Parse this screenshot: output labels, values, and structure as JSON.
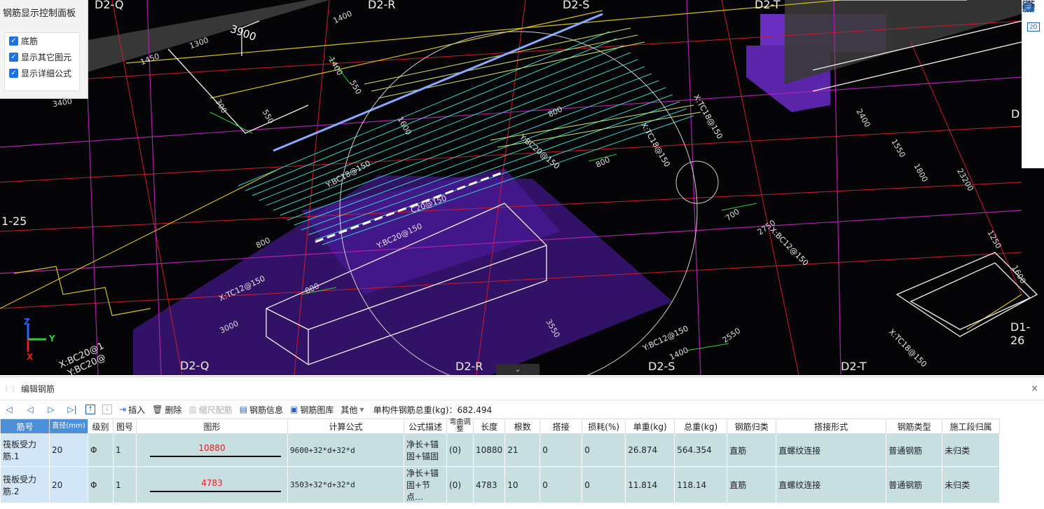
{
  "panel": {
    "title": "钢筋显示控制面板",
    "options": [
      {
        "label": "底筋",
        "checked": true
      },
      {
        "label": "显示其它图元",
        "checked": true
      },
      {
        "label": "显示详细公式",
        "checked": true
      }
    ]
  },
  "viewport": {
    "axis_labels": {
      "d2q_top": "D2-Q",
      "d2r_top": "D2-R",
      "d2s_top": "D2-S",
      "d2t_top": "D2-T",
      "d2q_bot": "D2-Q",
      "d2r_bot": "D2-R",
      "d2s_bot": "D2-S",
      "d2t_bot": "D2-T",
      "left_125": "1-25",
      "right_d1_26": "D1-26",
      "right_d": "D"
    },
    "dims": [
      "3900",
      "1450",
      "1300",
      "3400",
      "1400",
      "1400",
      "550",
      "300",
      "550",
      "1600",
      "800",
      "800",
      "800",
      "800",
      "3000",
      "3550",
      "1400",
      "2550",
      "2750",
      "2400",
      "1550",
      "1800",
      "23200",
      "1250",
      "1600",
      "700"
    ],
    "rebar_labels": {
      "ybc_left": "Y:BC18@150",
      "xt_right": "X:TC18@150",
      "xt_mid": "X:TC18@150",
      "y_bc20": "Y:BC20@150",
      "c20": "C20@150",
      "xt_lower": "X:TC12@150",
      "ybc_lower": "Y:BC20@150",
      "xt_bot": "X:TC18@150",
      "ybc_bot": "Y:BC12@150",
      "x_bc": "X:BC20@1",
      "y_bc": "Y:BC20@",
      "xbc_right": "X:BC12@150"
    },
    "gizmo": {
      "z": "Z",
      "y": "Y",
      "x": "X"
    },
    "collapse_glyph": "⌄"
  },
  "right_toolbar": {
    "icons": [
      "orbit-icon",
      "2d-view-icon",
      "cube-view-icon",
      "cube-solid-icon",
      "select-box-icon",
      "iso-cube-icon",
      "list-view-icon"
    ],
    "label_2d": "2D"
  },
  "editor": {
    "title": "编辑钢筋",
    "close_glyph": "×",
    "toolbar": {
      "insert": "插入",
      "delete": "删除",
      "scale": "缩尺配筋",
      "info": "钢筋信息",
      "library": "钢筋图库",
      "other": "其他",
      "total_label": "单构件钢筋总重(kg)：682.494"
    },
    "columns": [
      "筋号",
      "直径(mm)",
      "级别",
      "图号",
      "图形",
      "计算公式",
      "公式描述",
      "弯曲调整",
      "长度",
      "根数",
      "搭接",
      "损耗(%)",
      "单重(kg)",
      "总重(kg)",
      "钢筋归类",
      "搭接形式",
      "钢筋类型",
      "施工段归属"
    ],
    "rows": [
      {
        "name": "筏板受力筋.1",
        "diameter": "20",
        "grade": "Φ",
        "fig": "1",
        "shape_value": "10880",
        "formula": "9600+32*d+32*d",
        "desc": "净长+锚固+锚固",
        "bend": "(0)",
        "length": "10880",
        "count": "21",
        "lap": "0",
        "loss": "0",
        "unit_w": "26.874",
        "total_w": "564.354",
        "category": "直筋",
        "lap_type": "直螺纹连接",
        "rebar_type": "普通钢筋",
        "segment": "未归类"
      },
      {
        "name": "筏板受力筋.2",
        "diameter": "20",
        "grade": "Φ",
        "fig": "1",
        "shape_value": "4783",
        "formula": "3503+32*d+32*d",
        "desc": "净长+锚固+节点…",
        "bend": "(0)",
        "length": "4783",
        "count": "10",
        "lap": "0",
        "loss": "0",
        "unit_w": "11.814",
        "total_w": "118.14",
        "category": "直筋",
        "lap_type": "直螺纹连接",
        "rebar_type": "普通钢筋",
        "segment": "未归类"
      }
    ]
  }
}
